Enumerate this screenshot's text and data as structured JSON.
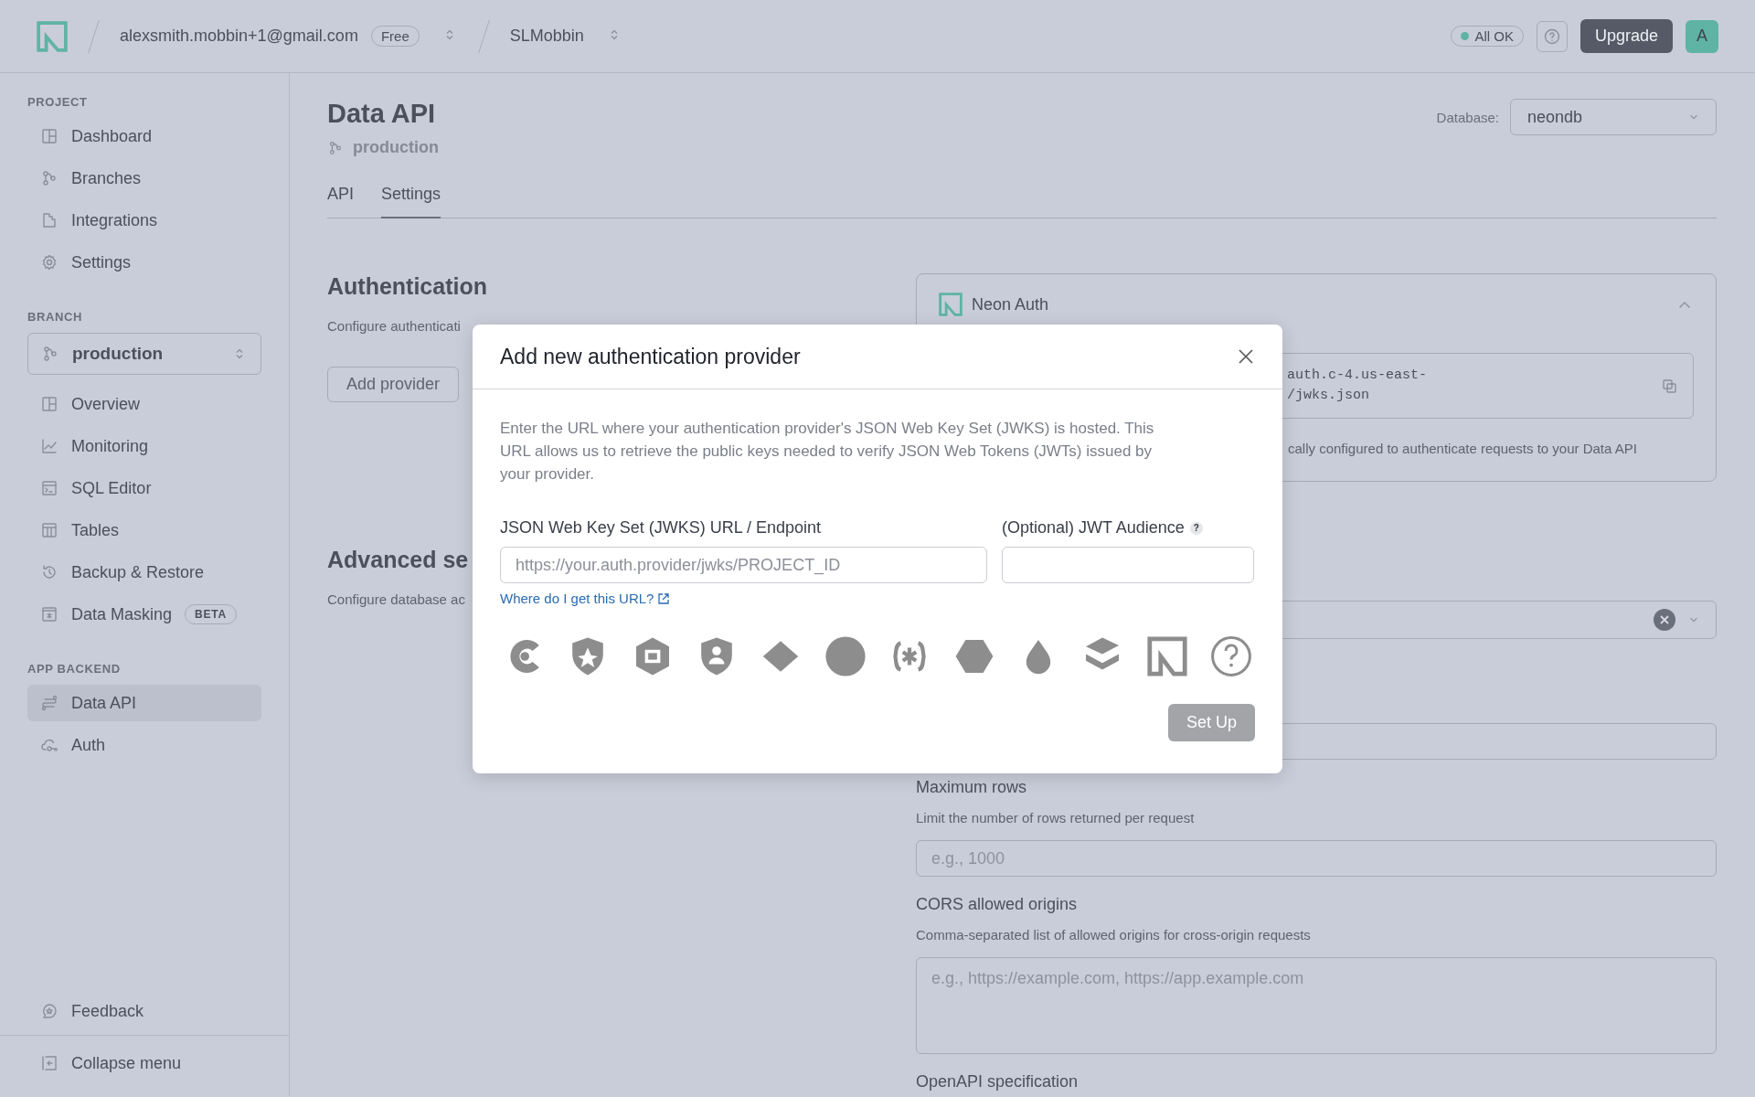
{
  "topbar": {
    "account": "alexsmith.mobbin+1@gmail.com",
    "plan": "Free",
    "project": "SLMobbin",
    "status": "All OK",
    "upgrade": "Upgrade",
    "avatar": "A"
  },
  "sidebar": {
    "sections": [
      {
        "heading": "PROJECT",
        "items": [
          {
            "label": "Dashboard",
            "selected": false
          },
          {
            "label": "Branches",
            "selected": false
          },
          {
            "label": "Integrations",
            "selected": false
          },
          {
            "label": "Settings",
            "selected": false
          }
        ]
      },
      {
        "heading": "BRANCH",
        "branch_selector": "production",
        "items": [
          {
            "label": "Overview",
            "selected": false
          },
          {
            "label": "Monitoring",
            "selected": false
          },
          {
            "label": "SQL Editor",
            "selected": false
          },
          {
            "label": "Tables",
            "selected": false
          },
          {
            "label": "Backup & Restore",
            "selected": false
          },
          {
            "label": "Data Masking",
            "badge": "BETA",
            "selected": false
          }
        ]
      },
      {
        "heading": "APP BACKEND",
        "items": [
          {
            "label": "Data API",
            "selected": true
          },
          {
            "label": "Auth",
            "selected": false
          }
        ]
      }
    ],
    "footer": [
      {
        "label": "Feedback"
      },
      {
        "label": "Collapse menu"
      }
    ]
  },
  "main": {
    "title": "Data API",
    "branch": "production",
    "database_label": "Database:",
    "database": "neondb",
    "tabs": [
      {
        "label": "API",
        "selected": false
      },
      {
        "label": "Settings",
        "selected": true
      }
    ],
    "authentication": {
      "heading": "Authentication",
      "description": "Configure authenticati",
      "button": "Add provider"
    },
    "advanced": {
      "heading": "Advanced se",
      "description": "Configure database ac"
    },
    "neon_auth_card": {
      "title": "Neon Auth",
      "url_lines": [
        "auth.c-4.us-east-",
        "/jwks.json"
      ],
      "note": "cally configured to authenticate requests to your Data API"
    },
    "settings_fields": [
      {
        "kind": "select"
      },
      {
        "kind": "input"
      },
      {
        "kind": "input",
        "label": "Maximum rows",
        "description": "Limit the number of rows returned per request",
        "placeholder": "e.g., 1000"
      },
      {
        "kind": "textarea",
        "label": "CORS allowed origins",
        "description": "Comma-separated list of allowed origins for cross-origin requests",
        "placeholder": "e.g., https://example.com, https://app.example.com"
      },
      {
        "kind": "heading",
        "label": "OpenAPI specification"
      }
    ]
  },
  "modal": {
    "title": "Add new authentication provider",
    "description": "Enter the URL where your authentication provider's JSON Web Key Set (JWKS) is hosted. This URL allows us to retrieve the public keys needed to verify JSON Web Tokens (JWTs) issued by your provider.",
    "fields": [
      {
        "label": "JSON Web Key Set (JWKS) URL / Endpoint",
        "placeholder": "https://your.auth.provider/jwks/PROJECT_ID"
      },
      {
        "label": "(Optional) JWT Audience",
        "help": "?"
      }
    ],
    "help_link": "Where do I get this URL?",
    "submit": "Set Up",
    "submit_disabled": true
  }
}
